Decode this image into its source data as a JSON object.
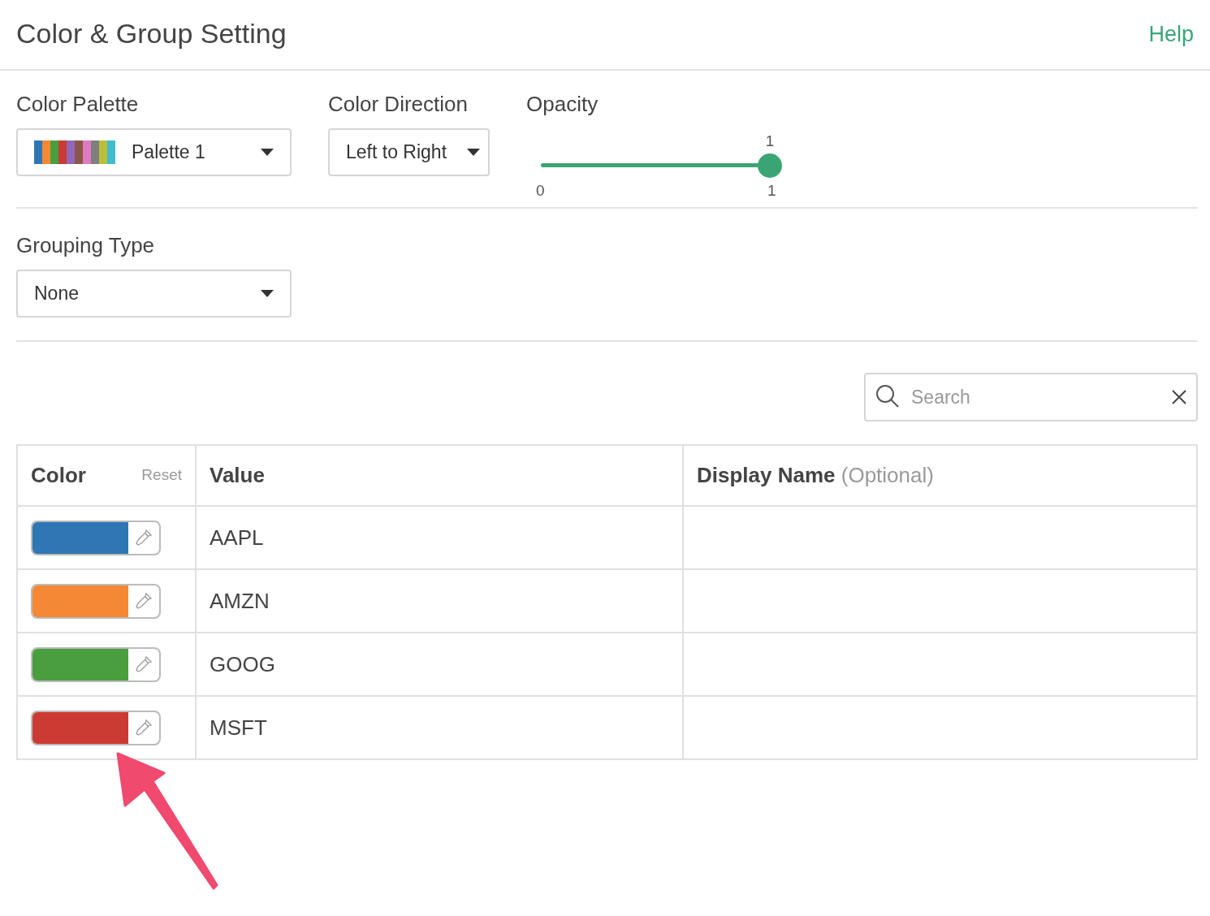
{
  "header": {
    "title": "Color & Group Setting",
    "help": "Help"
  },
  "color_palette": {
    "label": "Color Palette",
    "value": "Palette 1",
    "swatches": [
      {
        "color": "#2e77b4"
      },
      {
        "color": "#f58834"
      },
      {
        "color": "#4a9e3f"
      },
      {
        "color": "#cc3b33"
      },
      {
        "color": "#9167b8"
      },
      {
        "color": "#8b564b"
      },
      {
        "color": "#e07bc1"
      },
      {
        "color": "#7f7f7f"
      },
      {
        "color": "#bcbd3a"
      },
      {
        "color": "#3fbccd"
      }
    ]
  },
  "color_direction": {
    "label": "Color Direction",
    "value": "Left to Right"
  },
  "opacity": {
    "label": "Opacity",
    "value_label": "1",
    "min_label": "0",
    "max_label": "1",
    "level": 1
  },
  "grouping_type": {
    "label": "Grouping Type",
    "value": "None"
  },
  "search": {
    "placeholder": "Search"
  },
  "table": {
    "columns": [
      {
        "label": "Color",
        "action": "Reset"
      },
      {
        "label": "Value"
      },
      {
        "label": "Display Name",
        "hint": "(Optional)"
      }
    ],
    "rows": [
      {
        "color": "#2e77b4",
        "value": "AAPL"
      },
      {
        "color": "#f58834",
        "value": "AMZN"
      },
      {
        "color": "#4a9e3f",
        "value": "GOOG"
      },
      {
        "color": "#cc3b33",
        "value": "MSFT"
      }
    ]
  }
}
